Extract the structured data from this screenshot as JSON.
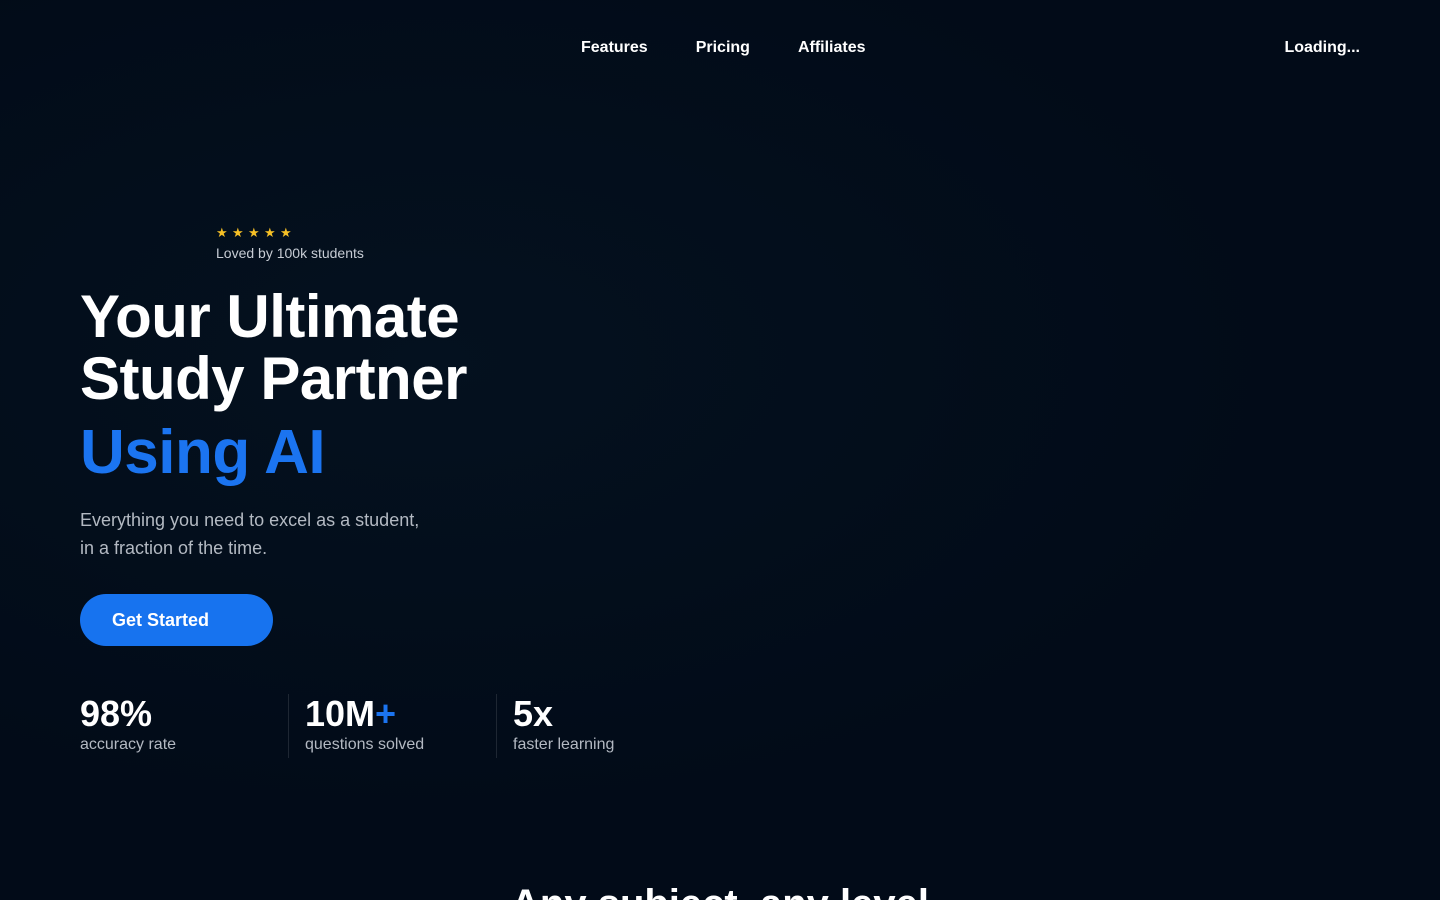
{
  "nav": {
    "links": [
      {
        "label": "Features"
      },
      {
        "label": "Pricing"
      },
      {
        "label": "Affiliates"
      }
    ],
    "status": "Loading..."
  },
  "hero": {
    "rating": {
      "stars": 5,
      "star_icon": "star-icon",
      "star_color": "#f6c026",
      "text": "Loved by 100k students"
    },
    "headline": [
      "Your Ultimate",
      "Study Partner"
    ],
    "headline_accent": "Using AI",
    "accent_color": "#1b74f0",
    "subtext": [
      "Everything you need to excel as a student,",
      "in a fraction of the time."
    ],
    "cta_label": "Get Started"
  },
  "stats": [
    {
      "value": "98%",
      "suffix": "",
      "label": "accuracy rate"
    },
    {
      "value": "10M",
      "suffix": "+",
      "label": "questions solved"
    },
    {
      "value": "5x",
      "suffix": "",
      "label": "faster learning"
    }
  ],
  "next_section": {
    "title": "Any subject, any level"
  },
  "colors": {
    "background": "#020b18",
    "primary": "#1773ef",
    "text": "#ffffff",
    "muted": "#b3b9c2"
  }
}
